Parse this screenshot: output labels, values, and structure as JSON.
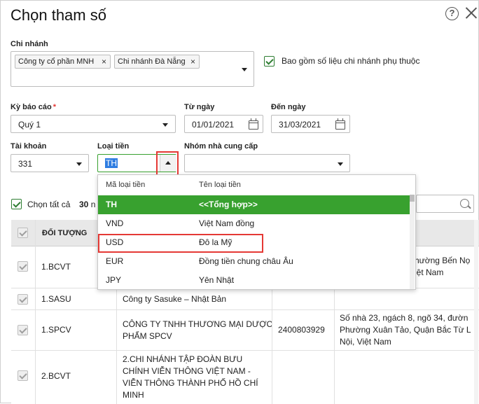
{
  "dialog": {
    "title": "Chọn tham số",
    "help_symbol": "?"
  },
  "branch": {
    "label": "Chi nhánh",
    "tags": [
      "Công ty cổ phần MNH",
      "Chi nhánh Đà Nẵng"
    ],
    "tag_remove": "×",
    "include_dependent_label": "Bao gồm số liệu chi nhánh phụ thuộc"
  },
  "period": {
    "label": "Kỳ báo cáo",
    "required_mark": "*",
    "value": "Quý 1"
  },
  "from_date": {
    "label": "Từ ngày",
    "value": "01/01/2021"
  },
  "to_date": {
    "label": "Đến ngày",
    "value": "31/03/2021"
  },
  "account": {
    "label": "Tài khoản",
    "value": "331"
  },
  "currency": {
    "label": "Loại tiền",
    "value": "TH",
    "dropdown": {
      "col_code": "Mã loại tiền",
      "col_name": "Tên loại tiền",
      "options": [
        {
          "code": "TH",
          "name": "<<Tổng hợp>>"
        },
        {
          "code": "VND",
          "name": "Việt Nam đồng"
        },
        {
          "code": "USD",
          "name": "Đô la Mỹ"
        },
        {
          "code": "EUR",
          "name": "Đồng tiền chung châu Âu"
        },
        {
          "code": "JPY",
          "name": "Yên Nhật"
        }
      ],
      "selected_index": 0,
      "highlighted_index": 2
    }
  },
  "supplier_group": {
    "label": "Nhóm nhà cung cấp",
    "value": ""
  },
  "select_all": {
    "label": "Chọn tất cả",
    "count": "30",
    "count_suffix": "n"
  },
  "table": {
    "header_object": "ĐỐI TƯỢNG",
    "rows": [
      {
        "code": "1.BCVT",
        "name": "",
        "tax": "",
        "address_lines": [
          "hường Bến Nọ",
          "iệt Nam"
        ]
      },
      {
        "code": "1.SASU",
        "name_lines": [
          "Công ty Sasuke – Nhật Bản"
        ],
        "tax": "",
        "address_lines": []
      },
      {
        "code": "1.SPCV",
        "name_lines": [
          "CÔNG TY TNHH THƯƠNG MẠI DƯỢC",
          "PHẨM SPCV"
        ],
        "tax": "2400803929",
        "address_lines": [
          "Số nhà 23, ngách 8, ngõ 34, đườn",
          "Phường Xuân Tảo, Quận Bắc Từ L",
          "Nội, Việt Nam"
        ]
      },
      {
        "code": "2.BCVT",
        "name_lines": [
          "2.CHI NHÁNH TẬP ĐOÀN BƯU",
          "CHÍNH VIỄN THÔNG VIỆT NAM -",
          "VIỄN THÔNG THÀNH PHỐ HỒ CHÍ",
          "MINH"
        ],
        "tax": "",
        "address_lines": []
      }
    ]
  },
  "colors": {
    "accent_green": "#38a12f",
    "highlight_red": "#e53935",
    "header_gray": "#e8e8e8"
  }
}
